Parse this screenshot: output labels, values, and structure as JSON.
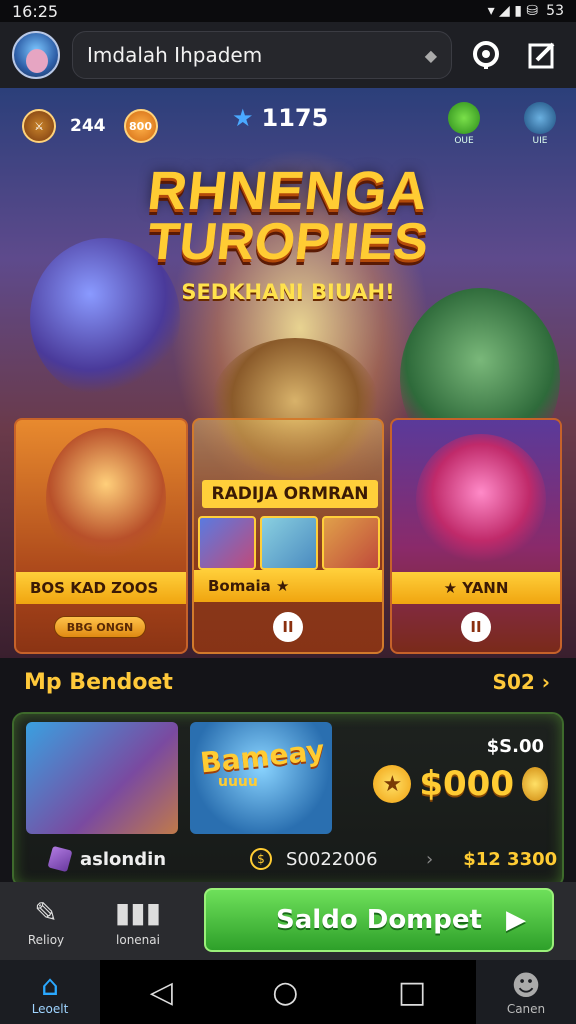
{
  "status_bar": {
    "time": "16:25",
    "icons": "▾ ◢ ▮ ⛁",
    "battery": "53"
  },
  "top_bar": {
    "search_text": "Imdalah Ihpadem",
    "search_icon": "◆",
    "icon_support": "support-icon",
    "icon_edit": "edit-icon"
  },
  "hero": {
    "stat_left_value": "244",
    "coin_label": "800",
    "star_value": "1175",
    "mini_left_label": "OUE",
    "mini_right_label": "UIE",
    "title_line1": "RHNENGA",
    "title_line2": "TUROPIIES",
    "subtitle": "SEDKHANI BIUAH!",
    "cards": [
      {
        "label": "BOS KAD ZOOS",
        "pill": "BBG ONGN"
      },
      {
        "banner": "RADIJA ORMRAN",
        "label": "Bomaia ★",
        "button": "II"
      },
      {
        "label": "★ YANN",
        "button": "II"
      }
    ]
  },
  "section": {
    "title": "Mp Bendoet",
    "more": "S02 ›"
  },
  "feature": {
    "thumb_title": "Bameay",
    "thumb_sub": "uuuu",
    "price_small": "$S.00",
    "price_big": "$000",
    "row": {
      "left": "aslondin",
      "mid": "S0022006",
      "sep": "›",
      "right": "$12 3300"
    }
  },
  "action_bar": {
    "left_label": "Relioy",
    "mid_label": "lonenai",
    "cta": "Saldo Dompet"
  },
  "nav": {
    "home_label": "Leoelt",
    "account_label": "Canen"
  },
  "colors": {
    "accent": "#ffcc33",
    "cta": "#3db83a",
    "nav_active": "#2aa8ff"
  }
}
